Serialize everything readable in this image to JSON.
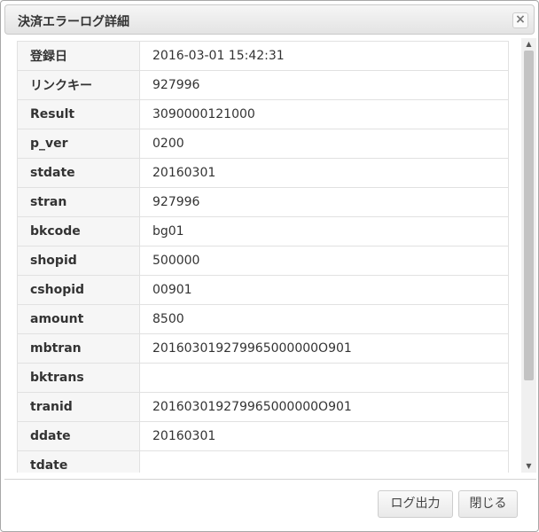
{
  "dialog": {
    "title": "決済エラーログ詳細",
    "close_symbol": "×"
  },
  "rows": [
    {
      "key": "登録日",
      "value": "2016-03-01 15:42:31"
    },
    {
      "key": "リンクキー",
      "value": "927996"
    },
    {
      "key": "Result",
      "value": "3090000121000"
    },
    {
      "key": "p_ver",
      "value": "0200"
    },
    {
      "key": "stdate",
      "value": "20160301"
    },
    {
      "key": "stran",
      "value": "927996"
    },
    {
      "key": "bkcode",
      "value": "bg01"
    },
    {
      "key": "shopid",
      "value": "500000"
    },
    {
      "key": "cshopid",
      "value": "00901"
    },
    {
      "key": "amount",
      "value": "8500"
    },
    {
      "key": "mbtran",
      "value": "201603019279965000000O901"
    },
    {
      "key": "bktrans",
      "value": ""
    },
    {
      "key": "tranid",
      "value": "201603019279965000000O901"
    },
    {
      "key": "ddate",
      "value": "20160301"
    },
    {
      "key": "tdate",
      "value": ""
    }
  ],
  "scrollbar": {
    "up_icon": "▲",
    "down_icon": "▼"
  },
  "footer": {
    "export_label": "ログ出力",
    "close_label": "閉じる"
  }
}
